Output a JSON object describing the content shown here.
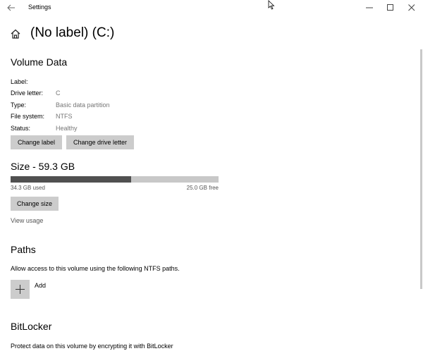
{
  "window": {
    "title": "Settings"
  },
  "page": {
    "title": "(No label) (C:)"
  },
  "volume": {
    "section_title": "Volume Data",
    "properties": [
      {
        "label": "Label:",
        "value": ""
      },
      {
        "label": "Drive letter:",
        "value": "C"
      },
      {
        "label": "Type:",
        "value": "Basic data partition"
      },
      {
        "label": "File system:",
        "value": "NTFS"
      },
      {
        "label": "Status:",
        "value": "Healthy"
      }
    ],
    "change_label_button": "Change label",
    "change_drive_letter_button": "Change drive letter"
  },
  "size": {
    "section_title": "Size - 59.3 GB",
    "used_text": "34.3 GB used",
    "free_text": "25.0 GB free",
    "used_fraction": 0.578,
    "change_size_button": "Change size",
    "view_usage_link": "View usage"
  },
  "paths": {
    "section_title": "Paths",
    "description": "Allow access to this volume using the following NTFS paths.",
    "add_label": "Add"
  },
  "bitlocker": {
    "section_title": "BitLocker",
    "description": "Protect data on this volume by encrypting it with BitLocker"
  },
  "colors": {
    "usage_fill": "#505050",
    "usage_track": "#c8c8c8",
    "button_bg": "#cccccc"
  }
}
